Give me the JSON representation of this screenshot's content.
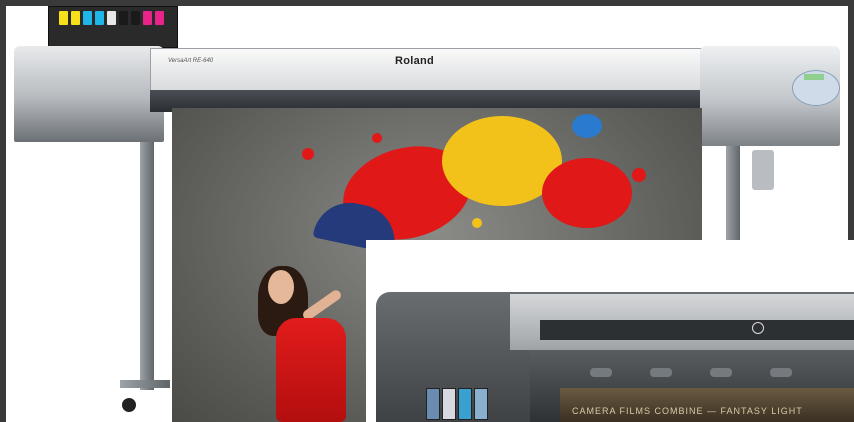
{
  "image": {
    "description": "Two wide-format printers: a Roland VersaArt printing a paint-splash banner with a woman holding an umbrella, and an inset of a dark large-format printer"
  },
  "printer_main": {
    "brand": "Roland",
    "model": "VersaArt RE-640"
  },
  "printer_inset": {
    "print_text": "CAMERA FILMS COMBINE — FANTASY LIGHT"
  },
  "colors": {
    "ink_cyan": "#1fb6e8",
    "ink_magenta": "#e8238a",
    "ink_yellow": "#f7e11a",
    "ink_black": "#1a1a1a",
    "splash_red": "#e01818",
    "splash_yellow": "#f2c21a",
    "dress_red": "#d41616",
    "umbrella_blue": "#243a7a"
  }
}
